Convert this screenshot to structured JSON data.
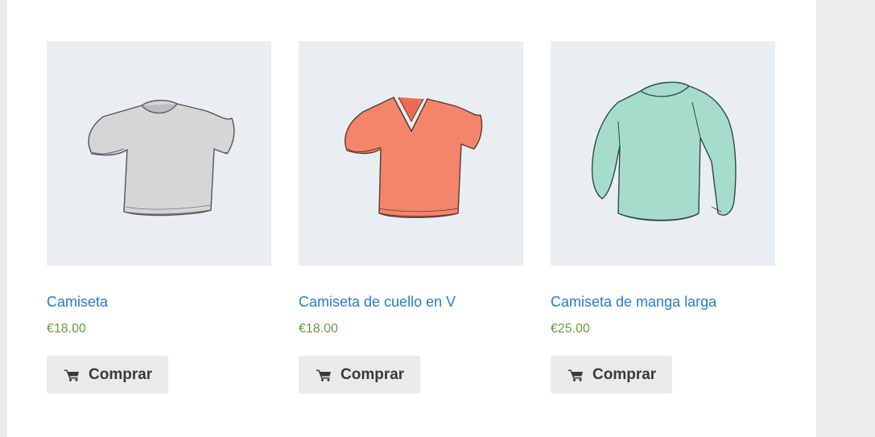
{
  "products": [
    {
      "name": "Camiseta",
      "price": "€18.00",
      "button_label": "Comprar",
      "image_icon": "tshirt-icon",
      "image_color": "#d6d6d6"
    },
    {
      "name": "Camiseta de cuello en V",
      "price": "€18.00",
      "button_label": "Comprar",
      "image_icon": "vneck-tshirt-icon",
      "image_color": "#f4846a"
    },
    {
      "name": "Camiseta de manga larga",
      "price": "€25.00",
      "button_label": "Comprar",
      "image_icon": "long-sleeve-shirt-icon",
      "image_color": "#a6dccb"
    }
  ],
  "colors": {
    "link": "#2a7bc2",
    "price": "#6a9a45",
    "image_bg": "#e9eef3",
    "button_bg": "#ebe9eb"
  }
}
